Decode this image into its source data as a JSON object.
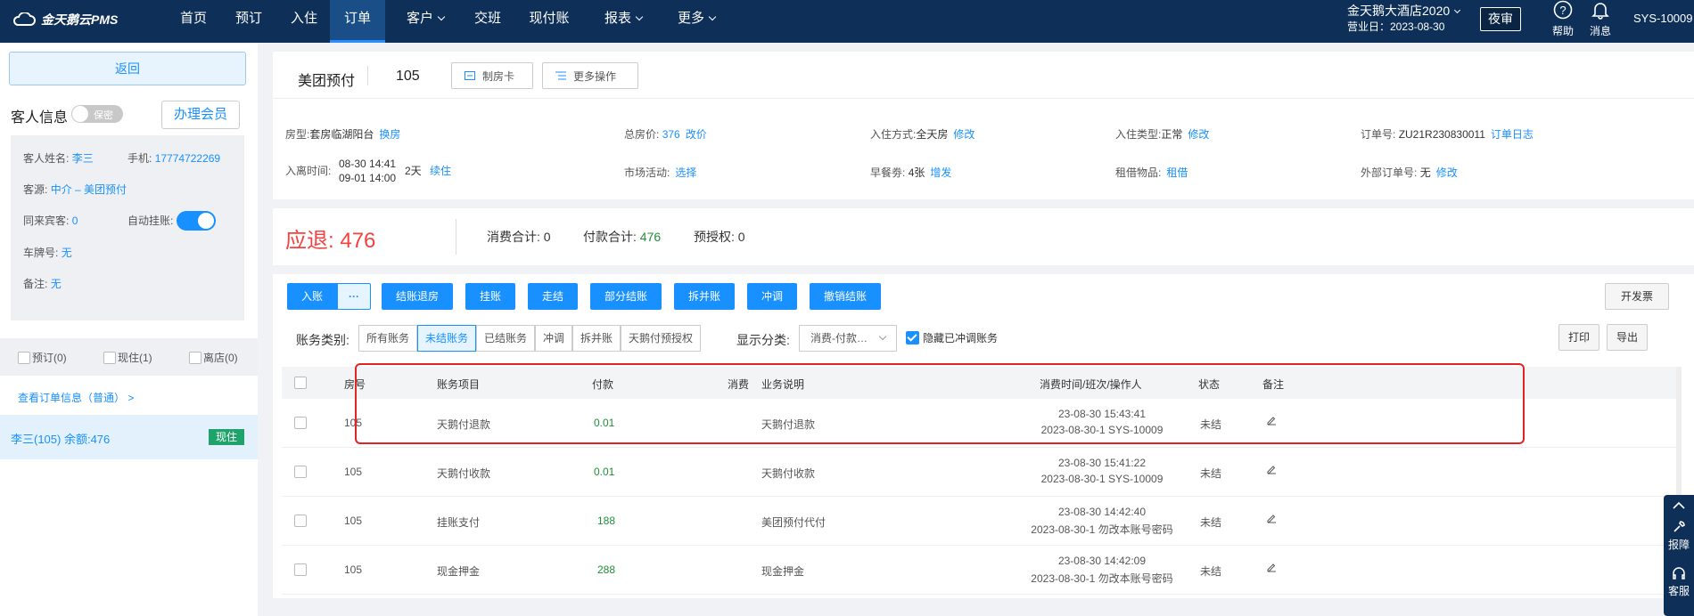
{
  "app": {
    "logo": "金天鹅云PMS"
  },
  "nav": [
    {
      "label": "首页",
      "dropdown": false
    },
    {
      "label": "预订",
      "dropdown": false
    },
    {
      "label": "入住",
      "dropdown": false
    },
    {
      "label": "订单",
      "dropdown": false,
      "active": true
    },
    {
      "label": "客户",
      "dropdown": true
    },
    {
      "label": "交班",
      "dropdown": false
    },
    {
      "label": "现付账",
      "dropdown": false
    },
    {
      "label": "报表",
      "dropdown": true
    },
    {
      "label": "更多",
      "dropdown": true
    }
  ],
  "header": {
    "hotel": "金天鹅大酒店2020",
    "biz_date": "营业日：2023-08-30",
    "audit": "夜审",
    "help": "帮助",
    "message": "消息",
    "user": "SYS-10009"
  },
  "sidebar": {
    "back": "返回",
    "guest_title": "客人信息",
    "secret": "保密",
    "member_btn": "办理会员",
    "name_label": "客人姓名:",
    "name": "李三",
    "phone_label": "手机:",
    "phone": "17774722269",
    "source_label": "客源:",
    "source": "中介  – 美团预付",
    "companions_label": "同来宾客:",
    "companions": "0",
    "auto_hang_label": "自动挂账:",
    "plate_label": "车牌号:",
    "plate": "无",
    "note_label": "备注:",
    "note": "无",
    "status_filters": [
      "预订(0)",
      "现住(1)",
      "离店(0)"
    ],
    "order_link": "查看订单信息（普通） >",
    "room_entry": "李三(105)  余额:476",
    "room_badge": "现住"
  },
  "order": {
    "type": "美团预付",
    "room": "105",
    "make_card": "制房卡",
    "more_ops": "更多操作",
    "fields": {
      "room_type_label": "房型:",
      "room_type": "套房临湖阳台",
      "room_type_action": "换房",
      "total_label": "总房价:",
      "total": "376",
      "total_action": "改价",
      "checkin_mode_label": "入住方式:",
      "checkin_mode": "全天房",
      "checkin_mode_action": "修改",
      "checkin_type_label": "入住类型:",
      "checkin_type": "正常",
      "checkin_type_action": "修改",
      "order_no_label": "订单号:",
      "order_no": "ZU21R230830011",
      "order_no_action": "订单日志",
      "stay_label": "入离时间:",
      "stay_in": "08-30 14:41",
      "stay_out": "09-01 14:00",
      "stay_days": "2天",
      "stay_action": "续住",
      "market_label": "市场活动:",
      "market_action": "选择",
      "breakfast_label": "早餐劵:",
      "breakfast": "4张",
      "breakfast_action": "增发",
      "rent_label": "租借物品:",
      "rent_action": "租借",
      "ext_order_label": "外部订单号:",
      "ext_order": "无",
      "ext_order_action": "修改"
    }
  },
  "summary": {
    "refund_label": "应退:",
    "refund": "476",
    "consume_label": "消费合计:",
    "consume": "0",
    "pay_label": "付款合计:",
    "pay": "476",
    "preauth_label": "预授权:",
    "preauth": "0"
  },
  "actions": {
    "post": "入账",
    "more": "···",
    "checkout_refund": "结账退房",
    "hang": "挂账",
    "walk": "走结",
    "partial": "部分结账",
    "split": "拆并账",
    "reverse": "冲调",
    "cancel_checkout": "撤销结账",
    "invoice": "开发票",
    "print": "打印",
    "export": "导出"
  },
  "filter": {
    "cat_label": "账务类别:",
    "cats": [
      "所有账务",
      "未结账务",
      "已结账务",
      "冲调",
      "拆并账",
      "天鹅付预授权"
    ],
    "cat_selected": 1,
    "disp_label": "显示分类:",
    "disp_value": "消费-付款…",
    "hide_label": "隐藏已冲调账务"
  },
  "table": {
    "headers": [
      "房号",
      "账务项目",
      "付款",
      "消费",
      "业务说明",
      "消费时间/班次/操作人",
      "状态",
      "备注"
    ],
    "rows": [
      {
        "room": "105",
        "item": "天鹅付退款",
        "pay": "0.01",
        "consume": "",
        "desc": "天鹅付退款",
        "time": "23-08-30 15:43:41",
        "shift": "2023-08-30-1 SYS-10009",
        "status": "未结"
      },
      {
        "room": "105",
        "item": "天鹅付收款",
        "pay": "0.01",
        "consume": "",
        "desc": "天鹅付收款",
        "time": "23-08-30 15:41:22",
        "shift": "2023-08-30-1 SYS-10009",
        "status": "未结"
      },
      {
        "room": "105",
        "item": "挂账支付",
        "pay": "188",
        "consume": "",
        "desc": "美团预付代付",
        "time": "23-08-30 14:42:40",
        "shift": "2023-08-30-1 勿改本账号密码",
        "status": "未结"
      },
      {
        "room": "105",
        "item": "现金押金",
        "pay": "288",
        "consume": "",
        "desc": "现金押金",
        "time": "23-08-30 14:42:09",
        "shift": "2023-08-30-1 勿改本账号密码",
        "status": "未结"
      }
    ]
  },
  "float": {
    "report": "报障",
    "service": "客服"
  }
}
